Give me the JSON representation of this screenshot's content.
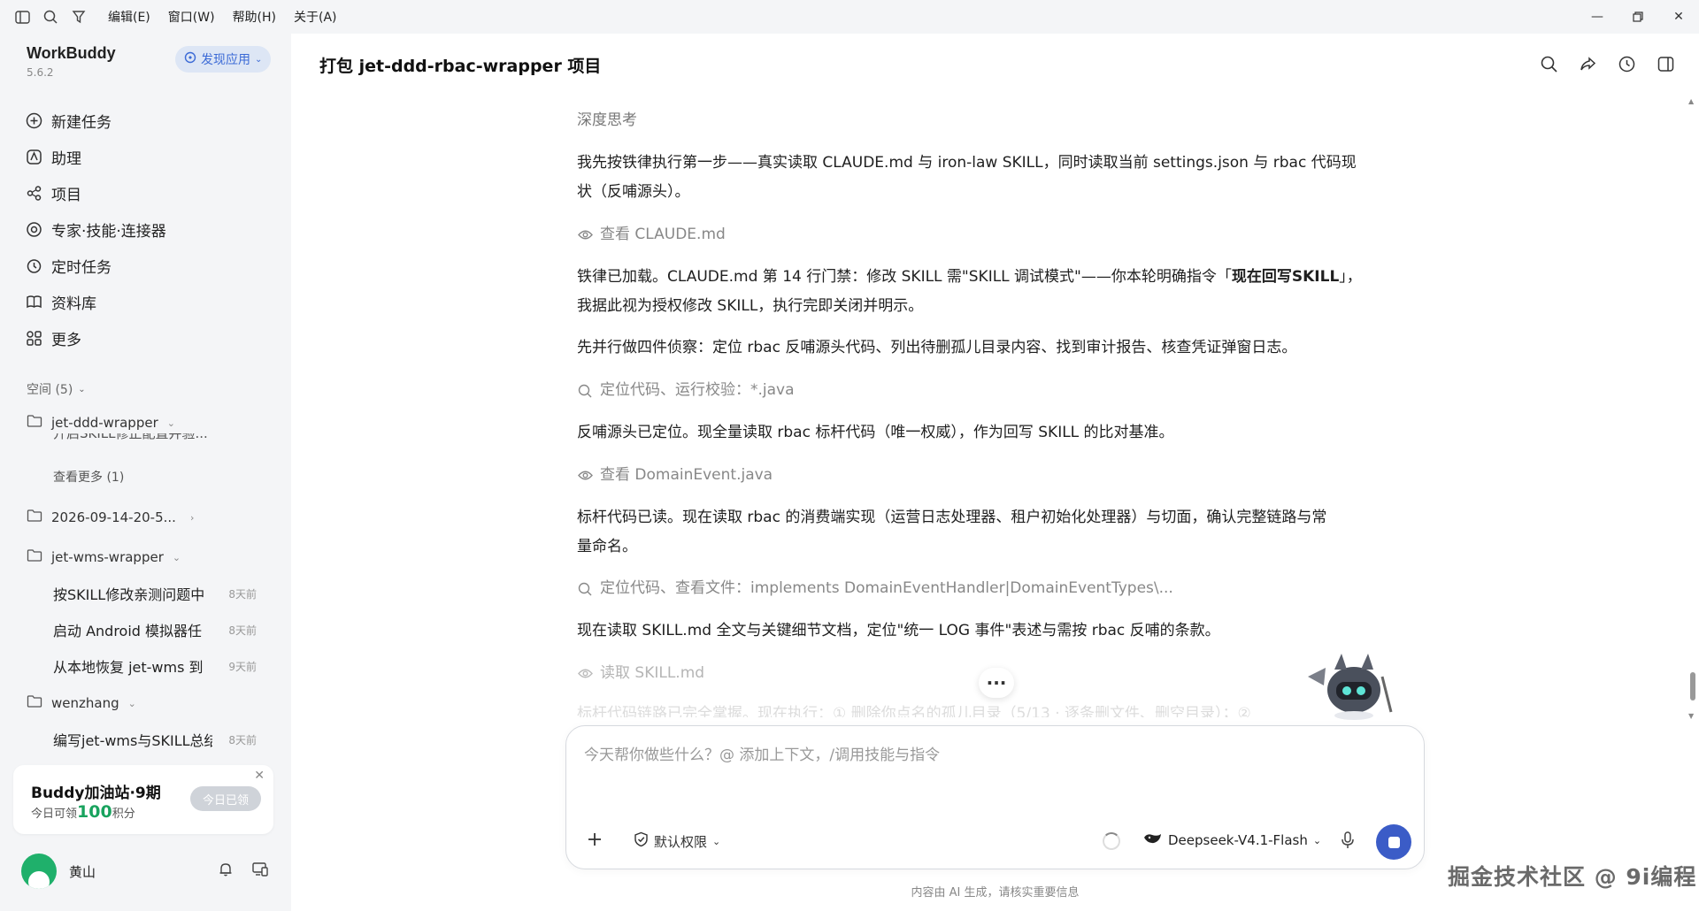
{
  "menu": [
    "编辑(E)",
    "窗口(W)",
    "帮助(H)",
    "关于(A)"
  ],
  "sidebar": {
    "brand": "WorkBuddy",
    "version": "5.6.2",
    "discover": "发现应用",
    "nav": [
      {
        "label": "新建任务",
        "icon": "plus-circle-icon"
      },
      {
        "label": "助理",
        "icon": "assistant-icon"
      },
      {
        "label": "项目",
        "icon": "project-icon"
      },
      {
        "label": "专家·技能·连接器",
        "icon": "skills-icon"
      },
      {
        "label": "定时任务",
        "icon": "clock-icon"
      },
      {
        "label": "资料库",
        "icon": "book-icon"
      },
      {
        "label": "更多",
        "icon": "grid-icon"
      }
    ],
    "space_label": "空间 (5)",
    "folders": [
      {
        "name": "jet-ddd-wrapper"
      },
      {
        "name": "2026-09-14-20-5..."
      },
      {
        "name": "jet-wms-wrapper"
      },
      {
        "name": "wenzhang"
      }
    ],
    "clipped_text": "开启SKILL修正配置并验...",
    "view_more": "查看更多 (1)",
    "wms_items": [
      {
        "label": "按SKILL修改亲测问题中",
        "time": "8天前"
      },
      {
        "label": "启动 Android 模拟器任",
        "time": "8天前"
      },
      {
        "label": "从本地恢复 jet-wms 到",
        "time": "9天前"
      }
    ],
    "wz_items": [
      {
        "label": "编写jet-wms与SKILL总结",
        "time": "8天前"
      }
    ],
    "promo": {
      "title": "Buddy加油站·9期",
      "sub_prefix": "今日可领",
      "points": "100",
      "sub_suffix": "积分",
      "button": "今日已领"
    },
    "user": "黄山"
  },
  "main": {
    "title": "打包 jet-ddd-rbac-wrapper 项目",
    "thinking": "深度思考",
    "p1a": "我先按铁律执行第一步——真实读取 CLAUDE.md 与 iron-law SKILL，同时读取当前 settings.json 与 rbac 代码现",
    "p1b": "状（反哺源头）。",
    "tool1": "查看 CLAUDE.md",
    "p2a_pre": "铁律已加载。CLAUDE.md 第 14 行门禁：修改 SKILL 需\"SKILL 调试模式\"——你本轮明确指令「",
    "p2a_bold": "现在回写SKILL",
    "p2a_post": "」，",
    "p2b": "我据此视为授权修改 SKILL，执行完即关闭并明示。",
    "p3": "先并行做四件侦察：定位 rbac 反哺源头代码、列出待删孤儿目录内容、找到审计报告、核查凭证弹窗日志。",
    "tool2": "定位代码、运行校验：*.java",
    "p4": "反哺源头已定位。现全量读取 rbac 标杆代码（唯一权威），作为回写 SKILL 的比对基准。",
    "tool3": "查看 DomainEvent.java",
    "p5a": "标杆代码已读。现在读取 rbac 的消费端实现（运营日志处理器、租户初始化处理器）与切面，确认完整链路与常",
    "p5b": "量命名。",
    "tool4": "定位代码、查看文件：implements DomainEventHandler|DomainEventTypes\\...",
    "p6": "现在读取 SKILL.md 全文与关键细节文档，定位\"统一 LOG 事件\"表述与需按 rbac 反哺的条款。",
    "tool5": "读取 SKILL.md",
    "p7": "标杆代码链路已完全掌握。现在执行：① 删除你点名的孤儿目录（5/13 · 逐条删文件、删空目录）；②"
  },
  "input": {
    "placeholder": "今天帮你做些什么？@ 添加上下文，/调用技能与指令",
    "permission": "默认权限",
    "model": "Deepseek-V4.1-Flash"
  },
  "disclaimer": "内容由 AI 生成，请核实重要信息",
  "watermark": "掘金技术社区 @ 9i编程"
}
